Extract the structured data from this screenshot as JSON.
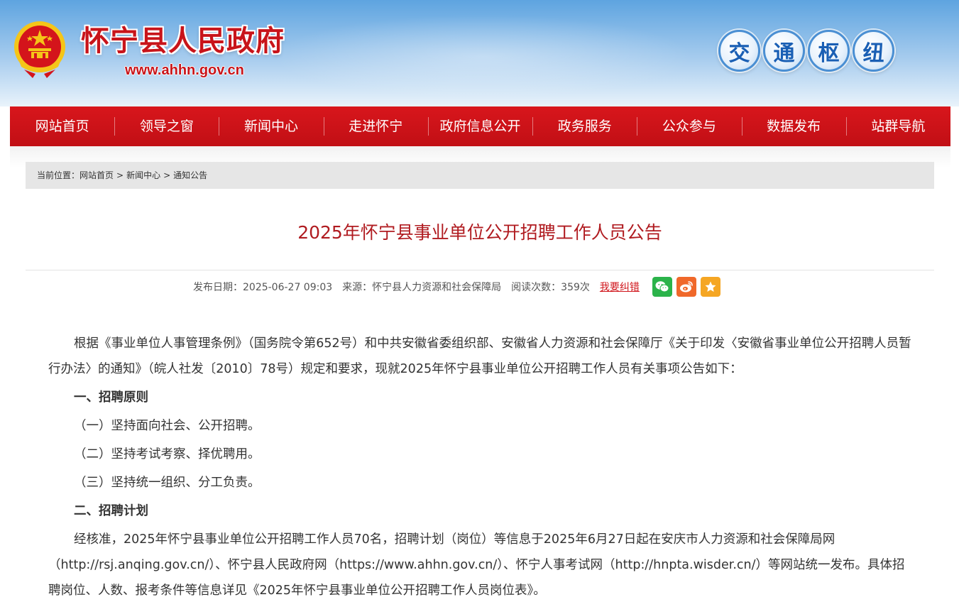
{
  "header": {
    "site_title": "怀宁县人民政府",
    "site_url": "www.ahhn.gov.cn",
    "hub_badges": [
      "交",
      "通",
      "枢",
      "纽"
    ],
    "emblem_icon": "national-emblem-icon"
  },
  "nav": {
    "items": [
      "网站首页",
      "领导之窗",
      "新闻中心",
      "走进怀宁",
      "政府信息公开",
      "政务服务",
      "公众参与",
      "数据发布",
      "站群导航"
    ]
  },
  "breadcrumb": {
    "prefix": "当前位置：",
    "items": [
      "网站首页",
      "新闻中心",
      "通知公告"
    ],
    "separator": ">"
  },
  "article": {
    "title": "2025年怀宁县事业单位公开招聘工作人员公告",
    "meta": {
      "publish_date": "发布日期：2025-06-27 09:03",
      "source": "来源：怀宁县人力资源和社会保障局",
      "read_count": "阅读次数：359次",
      "report_link": "我要纠错"
    },
    "share_icons": [
      "wechat-icon",
      "weibo-icon",
      "favorite-star-icon"
    ],
    "paragraphs": [
      "根据《事业单位人事管理条例》（国务院令第652号）和中共安徽省委组织部、安徽省人力资源和社会保障厅《关于印发〈安徽省事业单位公开招聘人员暂行办法〉的通知》（皖人社发〔2010〕78号）规定和要求，现就2025年怀宁县事业单位公开招聘工作人员有关事项公告如下：",
      "一、招聘原则",
      "（一）坚持面向社会、公开招聘。",
      "（二）坚持考试考察、择优聘用。",
      "（三）坚持统一组织、分工负责。",
      "二、招聘计划",
      "经核准，2025年怀宁县事业单位公开招聘工作人员70名，招聘计划（岗位）等信息于2025年6月27日起在安庆市人力资源和社会保障局网（http://rsj.anqing.gov.cn/）、怀宁县人民政府网（https://www.ahhn.gov.cn/）、怀宁人事考试网（http://hnpta.wisder.cn/）等网站统一发布。具体招聘岗位、人数、报考条件等信息详见《2025年怀宁县事业单位公开招聘工作人员岗位表》。"
    ]
  },
  "colors": {
    "nav_red": "#c10f15",
    "title_red": "#b01b20",
    "link_red": "#d0151b",
    "header_blue": "#5ea4e0"
  }
}
